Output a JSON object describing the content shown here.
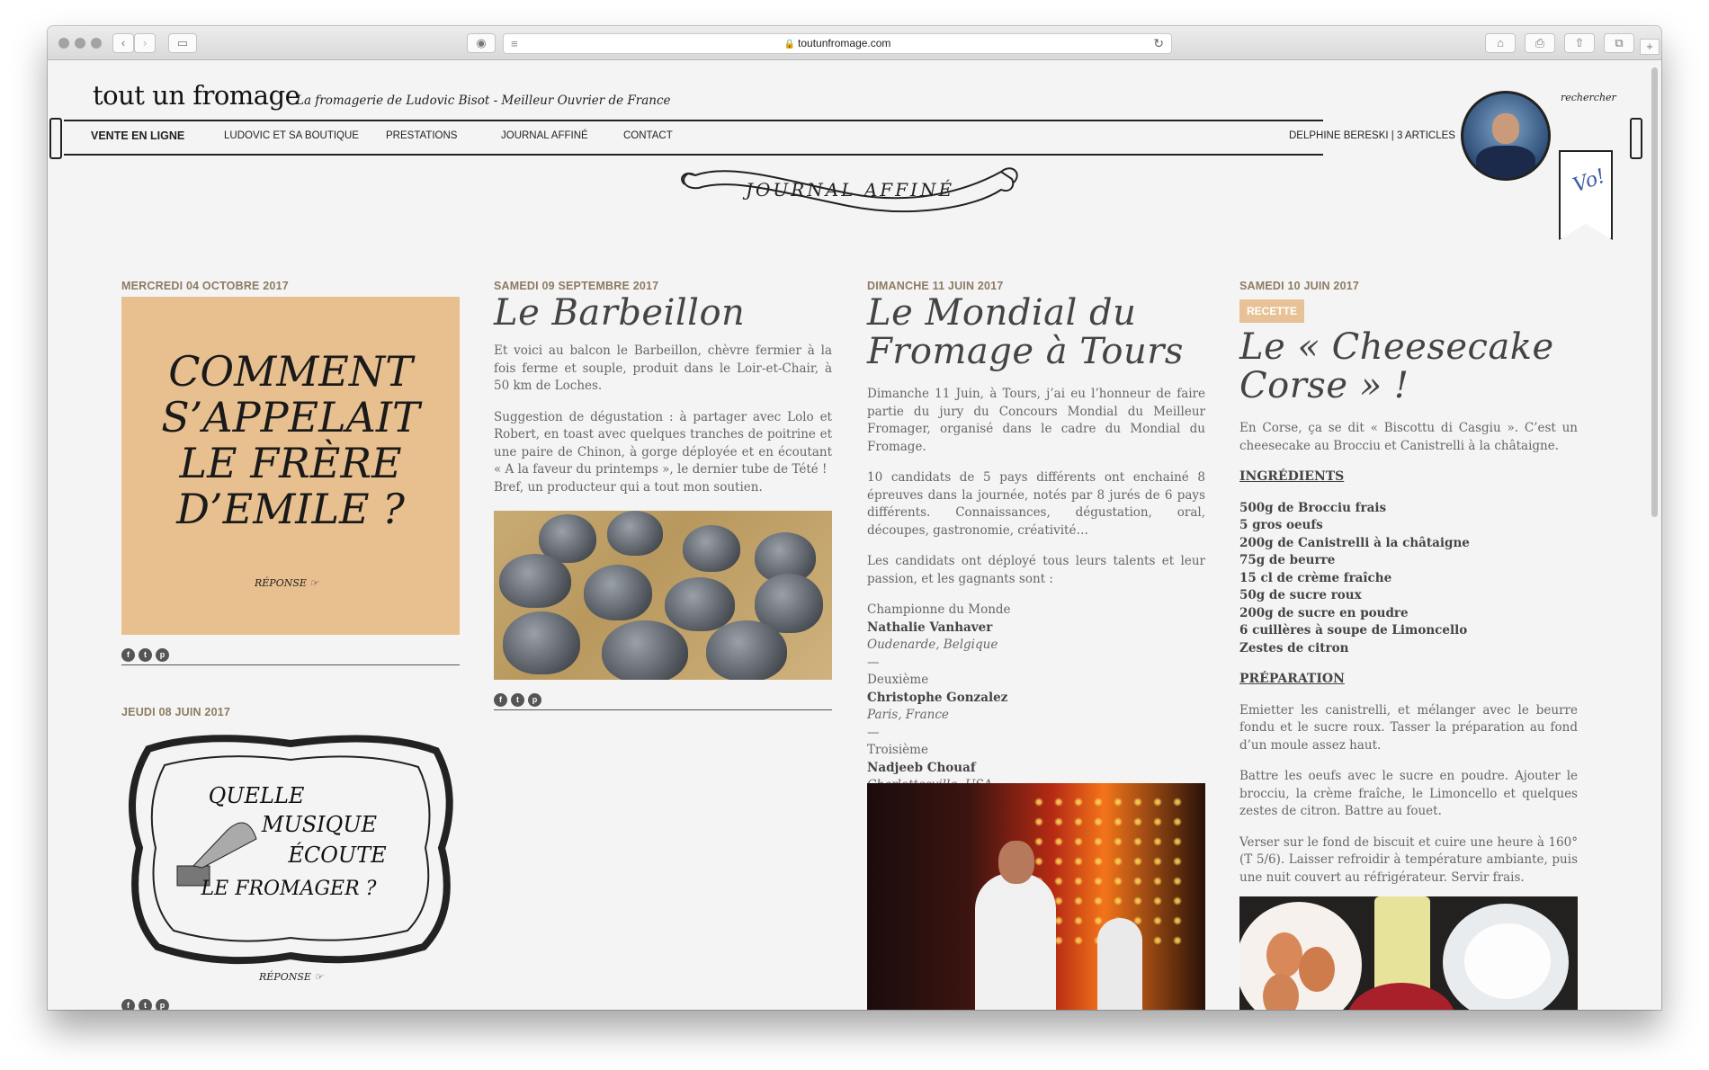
{
  "browser": {
    "url": "toutunfromage.com",
    "icons": [
      "back-icon",
      "forward-icon",
      "sidebar-icon",
      "privacy-icon",
      "reader-icon",
      "reload-icon",
      "home-icon",
      "print-icon",
      "share-icon",
      "tabs-icon",
      "new-tab-icon"
    ]
  },
  "site": {
    "logo": "tout un fromage",
    "tagline": "La fromagerie de Ludovic Bisot - Meilleur Ouvrier de France",
    "search": "rechercher",
    "nav": [
      "VENTE EN LIGNE",
      "LUDOVIC ET SA BOUTIQUE",
      "PRESTATIONS",
      "JOURNAL AFFINÉ",
      "CONTACT"
    ],
    "author": "DELPHINE BERESKI | 3 ARTICLES",
    "badge_text": "Vo!",
    "banner": "JOURNAL AFFINÉ"
  },
  "posts": {
    "p1": {
      "date": "MERCREDI 04 OCTOBRE 2017",
      "question": [
        "COMMENT",
        "S’APPELAIT",
        "LE FRÈRE",
        "D’EMILE ?"
      ],
      "reponse": "RÉPONSE"
    },
    "p2": {
      "date": "JEUDI 08 JUIN 2017",
      "question": [
        "QUELLE",
        "MUSIQUE",
        "ÉCOUTE",
        "LE FROMAGER ?"
      ],
      "reponse": "RÉPONSE"
    },
    "p3": {
      "date": "SAMEDI 09 SEPTEMBRE 2017",
      "title": "Le Barbeillon",
      "para1": "Et voici au balcon le Barbeillon, chèvre fermier à la fois ferme et souple, produit dans le Loir-et-Chair, à 50 km de Loches.",
      "para2": "Suggestion de dégustation : à partager avec Lolo et Robert, en toast avec quelques tranches de poitrine et une paire de Chinon, à gorge déployée et en écoutant « A la faveur du printemps », le dernier tube de Tété !",
      "para3": "Bref, un producteur qui a tout mon soutien."
    },
    "p4": {
      "date": "DIMANCHE 11 JUIN 2017",
      "title_l1": "Le Mondial du",
      "title_l2": "Fromage à Tours",
      "para1": "Dimanche 11 Juin, à Tours, j’ai eu l’honneur de faire partie du jury du Concours Mondial du Meilleur Fromager, organisé dans le cadre du Mondial du Fromage.",
      "para2": "10 candidats de 5 pays différents ont enchainé 8 épreuves dans la journée, notés par 8 jurés de 6 pays différents. Connaissances, dégustation, oral, découpes, gastronomie, créativité…",
      "para3": "Les candidats ont déployé tous leurs talents et leur passion, et les gagnants sont :",
      "w1_rank": "Championne du Monde",
      "w1_name": "Nathalie Vanhaver",
      "w1_place": "Oudenarde, Belgique",
      "sep": "—",
      "w2_rank": "Deuxième",
      "w2_name": "Christophe Gonzalez",
      "w2_place": "Paris, France",
      "w3_rank": "Troisième",
      "w3_name": "Nadjeeb Chouaf",
      "w3_place": "Charlottesville, USA"
    },
    "p5": {
      "date": "SAMEDI 10 JUIN 2017",
      "tag": "RECETTE",
      "title_l1": "Le « Cheesecake",
      "title_l2": "Corse » !",
      "intro": "En Corse, ça se dit « Biscottu di Casgiu ». C’est un cheesecake au Brocciu et Canistrelli à la châtaigne.",
      "ingredients_heading": "INGRÉDIENTS",
      "ingredients": [
        "500g de Brocciu frais",
        "5 gros oeufs",
        "200g de Canistrelli à la châtaigne",
        "75g de beurre",
        "15 cl de crème fraîche",
        "50g de sucre roux",
        "200g de sucre en poudre",
        "6 cuillères à soupe de Limoncello",
        "Zestes de citron"
      ],
      "prep_heading": "PRÉPARATION",
      "prep1": "Emietter les canistrelli, et mélanger avec le beurre fondu et le sucre roux. Tasser la préparation au fond d’un moule assez haut.",
      "prep2": "Battre les oeufs avec le sucre en poudre. Ajouter le brocciu, la crème fraîche, le Limoncello et quelques zestes de citron. Battre au fouet.",
      "prep3": "Verser sur le fond de biscuit et cuire une heure à 160° (T 5/6). Laisser refroidir à température ambiante, puis une nuit couvert au réfrigérateur. Servir frais."
    }
  },
  "social_icons": [
    "facebook-icon",
    "twitter-icon",
    "pinterest-icon"
  ]
}
